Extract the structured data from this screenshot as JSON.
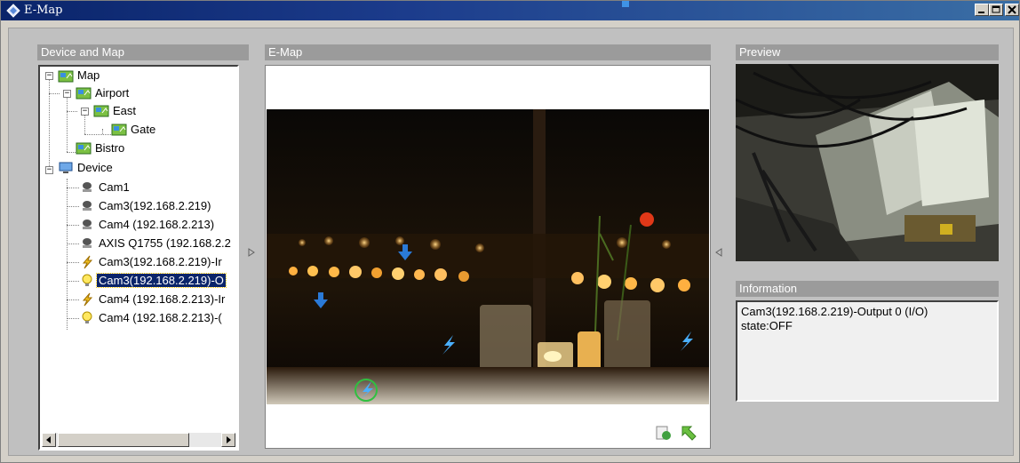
{
  "window": {
    "title": "E-Map"
  },
  "panels": {
    "device_header": "Device and Map",
    "emap_header": "E-Map",
    "preview_header": "Preview",
    "info_header": "Information"
  },
  "tree": {
    "nodes": [
      {
        "label": "Map",
        "icon": "map-icon"
      },
      {
        "label": "Airport",
        "icon": "map-icon"
      },
      {
        "label": "East",
        "icon": "map-icon"
      },
      {
        "label": "Gate",
        "icon": "map-icon"
      },
      {
        "label": "Bistro",
        "icon": "map-icon"
      },
      {
        "label": "Device",
        "icon": "computer-icon"
      },
      {
        "label": "Cam1",
        "icon": "camera-icon"
      },
      {
        "label": "Cam3(192.168.2.219)",
        "icon": "camera-icon"
      },
      {
        "label": "Cam4 (192.168.2.213)",
        "icon": "camera-icon"
      },
      {
        "label": "AXIS Q1755 (192.168.2.2",
        "icon": "camera-icon"
      },
      {
        "label": "Cam3(192.168.2.219)-Ir",
        "icon": "input-icon"
      },
      {
        "label": "Cam3(192.168.2.219)-O",
        "icon": "output-icon",
        "selected": true
      },
      {
        "label": "Cam4 (192.168.2.213)-Ir",
        "icon": "input-icon"
      },
      {
        "label": "Cam4 (192.168.2.213)-(",
        "icon": "output-icon"
      }
    ]
  },
  "info": {
    "line1": "Cam3(192.168.2.219)-Output 0 (I/O)",
    "line2": "state:OFF"
  },
  "colors": {
    "titlebar_start": "#0a246a",
    "titlebar_end": "#3a6ea5",
    "panel_header": "#9b9b9b",
    "selection": "#0a246a",
    "background": "#c0c0c0"
  }
}
